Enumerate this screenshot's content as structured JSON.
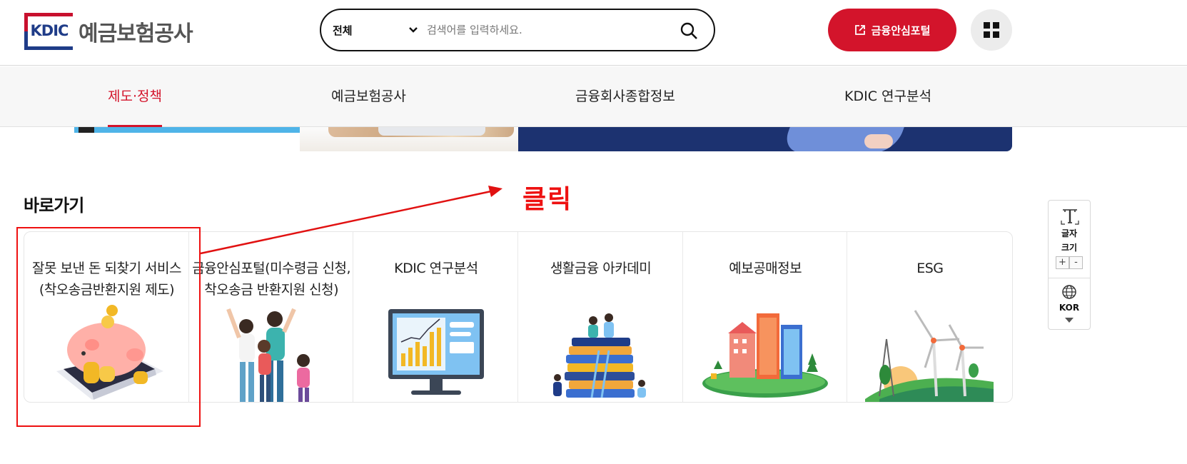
{
  "header": {
    "logo_mark": "KDIC",
    "logo_name": "예금보험공사",
    "search": {
      "scope": "전체",
      "placeholder": "검색어를 입력하세요."
    },
    "portal_button": "금융안심포털",
    "menu_icon": "grid-menu-icon"
  },
  "nav": {
    "items": [
      {
        "label": "제도·정책",
        "active": true
      },
      {
        "label": "예금보험공사",
        "active": false
      },
      {
        "label": "금융회사종합정보",
        "active": false
      },
      {
        "label": "KDIC 연구분석",
        "active": false
      }
    ]
  },
  "quick_links": {
    "title": "바로가기",
    "cards": [
      {
        "title_line1": "잘못 보낸 돈 되찾기 서비스",
        "title_line2": "(착오송금반환지원 제도)",
        "icon": "piggy-bank-phone-illustration"
      },
      {
        "title_line1": "금융안심포털(미수령금 신청,",
        "title_line2": "착오송금 반환지원 신청)",
        "icon": "happy-family-illustration"
      },
      {
        "title_line1": "KDIC 연구분석",
        "title_line2": "",
        "icon": "chart-monitor-illustration"
      },
      {
        "title_line1": "생활금융 아카데미",
        "title_line2": "",
        "icon": "stacked-books-illustration"
      },
      {
        "title_line1": "예보공매정보",
        "title_line2": "",
        "icon": "city-buildings-illustration"
      },
      {
        "title_line1": "ESG",
        "title_line2": "",
        "icon": "wind-turbines-illustration"
      }
    ]
  },
  "annotation": {
    "label": "클릭"
  },
  "side_widget": {
    "font_size_label_1": "글자",
    "font_size_label_2": "크기",
    "plus": "+",
    "minus": "-",
    "language": "KOR"
  },
  "colors": {
    "brand_red": "#d3142b",
    "brand_navy": "#1f3c88",
    "annotation_red": "#e11111"
  }
}
